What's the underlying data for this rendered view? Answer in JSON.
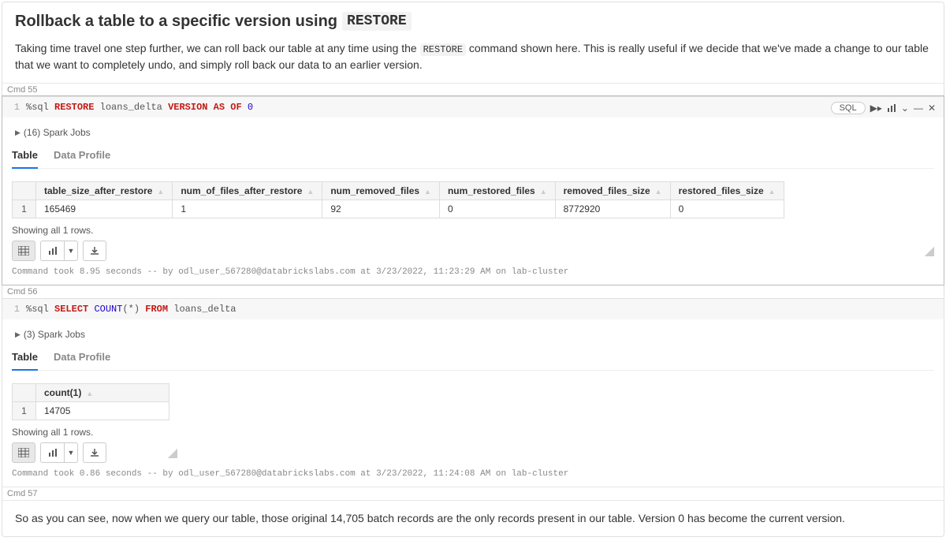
{
  "markdown1": {
    "title_pre": "Rollback a table to a specific version using",
    "title_code": "RESTORE",
    "body_pre": "Taking time travel one step further, we can roll back our table at any time using the",
    "body_code": "RESTORE",
    "body_post": "command shown here. This is really useful if we decide that we've made a change to our table that we want to completely undo, and simply roll back our data to an earlier version."
  },
  "cmd55_label": "Cmd 55",
  "cell1": {
    "line_no": "1",
    "magic": "%sql",
    "kw1": "RESTORE",
    "table": "loans_delta",
    "kw2": "VERSION AS OF",
    "num": "0",
    "lang_badge": "SQL",
    "spark_jobs": "(16) Spark Jobs",
    "tabs": {
      "table": "Table",
      "profile": "Data Profile"
    },
    "headers": [
      "table_size_after_restore",
      "num_of_files_after_restore",
      "num_removed_files",
      "num_restored_files",
      "removed_files_size",
      "restored_files_size"
    ],
    "row_idx": "1",
    "row": [
      "165469",
      "1",
      "92",
      "0",
      "8772920",
      "0"
    ],
    "status": "Showing all 1 rows.",
    "meta": "Command took 8.95 seconds -- by odl_user_567280@databrickslabs.com at 3/23/2022, 11:23:29 AM on lab-cluster"
  },
  "cmd56_label": "Cmd 56",
  "cell2": {
    "line_no": "1",
    "magic": "%sql",
    "kw1": "SELECT",
    "fn": "COUNT",
    "star": "(*)",
    "kw2": "FROM",
    "table": "loans_delta",
    "spark_jobs": "(3) Spark Jobs",
    "tabs": {
      "table": "Table",
      "profile": "Data Profile"
    },
    "headers": [
      "count(1)"
    ],
    "row_idx": "1",
    "row": [
      "14705"
    ],
    "status": "Showing all 1 rows.",
    "meta": "Command took 0.86 seconds -- by odl_user_567280@databrickslabs.com at 3/23/2022, 11:24:08 AM on lab-cluster"
  },
  "cmd57_label": "Cmd 57",
  "markdown2": {
    "body": "So as you can see, now when we query our table, those original 14,705 batch records are the only records present in our table. Version 0 has become the current version."
  }
}
